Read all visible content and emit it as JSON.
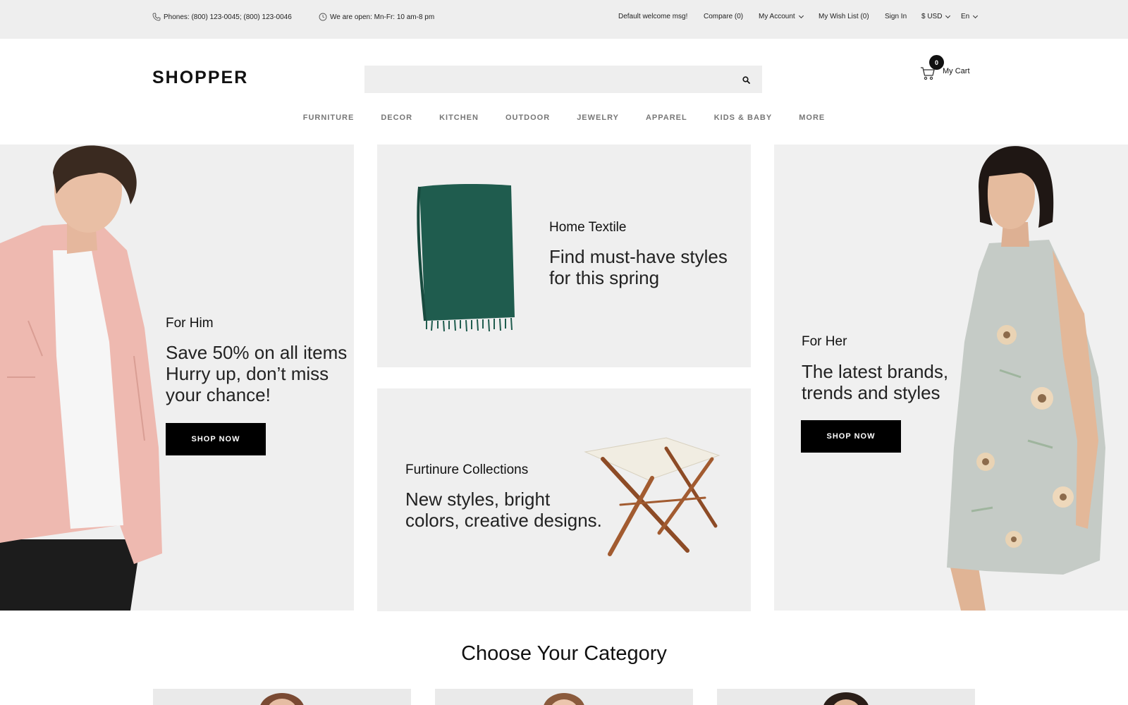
{
  "topbar": {
    "phones": "Phones: (800) 123-0045; (800) 123-0046",
    "hours": "We are open: Mn-Fr: 10 am-8 pm",
    "welcome": "Default welcome msg!",
    "compare": "Compare (0)",
    "account": "My Account",
    "wishlist": "My Wish List (0)",
    "signin": "Sign In",
    "currency": "$ USD",
    "language": "En"
  },
  "header": {
    "logo": "SHOPPER",
    "search_placeholder": "",
    "cart_count": "0",
    "cart_label": "My Cart"
  },
  "nav": [
    "FURNITURE",
    "DECOR",
    "KITCHEN",
    "OUTDOOR",
    "JEWELRY",
    "APPAREL",
    "KIDS & BABY",
    "MORE"
  ],
  "banners": {
    "him": {
      "title": "For Him",
      "lines": [
        "Save 50% on all items",
        "Hurry up, don’t miss",
        "your chance!"
      ],
      "button": "SHOP NOW"
    },
    "textile": {
      "title": "Home Textile",
      "lines": [
        "Find must-have styles",
        "for this spring"
      ]
    },
    "furniture": {
      "title": "Furtinure Collections",
      "lines": [
        "New styles, bright",
        "colors, creative designs."
      ]
    },
    "her": {
      "title": "For Her",
      "lines": [
        "The latest brands,",
        "trends and styles"
      ],
      "button": "SHOP NOW"
    }
  },
  "categories": {
    "title": "Choose Your Category"
  },
  "colors": {
    "topbar_bg": "#eeeeee",
    "banner_bg": "#efefef",
    "button_bg": "#000000",
    "accent": "#111111"
  }
}
